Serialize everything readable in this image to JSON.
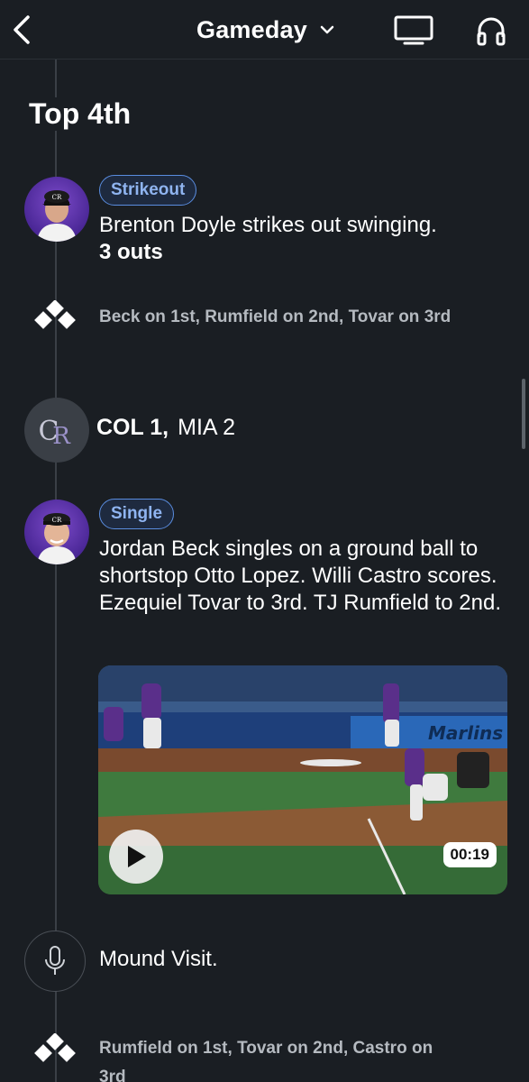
{
  "header": {
    "title": "Gameday",
    "icons": {
      "back": "chevron-left-icon",
      "dropdown": "chevron-down-icon",
      "tv": "tv-icon",
      "audio": "headphones-icon"
    }
  },
  "inning_label": "Top 4th",
  "events": [
    {
      "badge": "Strikeout",
      "description": "Brenton Doyle strikes out swinging.",
      "detail": "3 outs"
    },
    {
      "runners": "Beck on 1st, Rumfield on 2nd, Tovar on 3rd"
    },
    {
      "team_logo_text": "CR",
      "score_team1": "COL 1,",
      "score_team2": "MIA 2"
    },
    {
      "badge": "Single",
      "description": "Jordan Beck singles on a ground ball to shortstop Otto Lopez. Willi Castro scores. Ezequiel Tovar to 3rd. TJ Rumfield to 2nd.",
      "video": {
        "duration": "00:19",
        "sign_text": "Marlins"
      }
    },
    {
      "description": "Mound Visit."
    },
    {
      "runners": "Rumfield on 1st, Tovar on 2nd, Castro on 3rd"
    }
  ],
  "colors": {
    "background": "#1a1e23",
    "badge_border": "#5a8de0",
    "badge_text": "#8fb4f0",
    "rockies_purple": "#4a2796"
  }
}
